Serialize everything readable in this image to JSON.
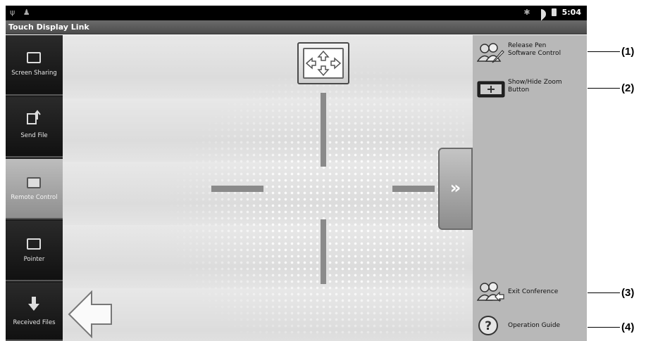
{
  "status_bar": {
    "time": "5:04",
    "left_icons": "usb-icon android-debug-icon",
    "right_icons": [
      "bluetooth-icon",
      "wifi-icon",
      "battery-icon"
    ]
  },
  "app": {
    "title": "Touch Display Link"
  },
  "side_menu": {
    "items": [
      {
        "label": "Screen Sharing",
        "icon": "monitor-icon",
        "active": false
      },
      {
        "label": "Send File",
        "icon": "send-file-icon",
        "active": false
      },
      {
        "label": "Remote Control",
        "icon": "remote-control-icon",
        "active": true
      },
      {
        "label": "Pointer",
        "icon": "pointer-icon",
        "active": false
      },
      {
        "label": "Received Files",
        "icon": "download-icon",
        "active": false
      }
    ]
  },
  "right_panel": {
    "items": [
      {
        "label_line1": "Release Pen",
        "label_line2": "Software Control",
        "icon": "users-pen-icon"
      },
      {
        "label_line1": "Show/Hide Zoom",
        "label_line2": "Button",
        "icon": "zoom-button-icon"
      },
      {
        "label_line1": "Exit Conference",
        "label_line2": "",
        "icon": "exit-users-icon"
      },
      {
        "label_line1": "Operation Guide",
        "label_line2": "",
        "icon": "question-icon"
      }
    ]
  },
  "callouts": [
    "(1)",
    "(2)",
    "(3)",
    "(4)"
  ],
  "colors": {
    "status_bar": "#000000",
    "title_bar": "#5a5a5a",
    "side_menu": "#1d1d1d",
    "active_menu": "#a8a8a8",
    "right_panel": "#b8b8b8",
    "main_area": "#e2e2e2"
  }
}
